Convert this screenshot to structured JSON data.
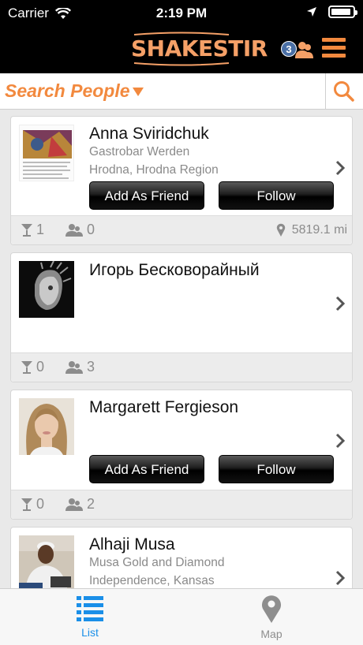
{
  "status": {
    "carrier": "Carrier",
    "time": "2:19 PM"
  },
  "header": {
    "logo": "SHAKESTIR",
    "friend_requests": "3"
  },
  "search": {
    "label": "Search People"
  },
  "people": [
    {
      "name": "Anna Sviridchuk",
      "place": "Gastrobar Werden",
      "location": "Hrodna, Hrodna Region",
      "add_friend": "Add As Friend",
      "follow": "Follow",
      "drinks": "1",
      "friends": "0",
      "distance": "5819.1 mi"
    },
    {
      "name": "Игорь Бесковорайный",
      "drinks": "0",
      "friends": "3"
    },
    {
      "name": "Margarett Fergieson",
      "add_friend": "Add As Friend",
      "follow": "Follow",
      "drinks": "0",
      "friends": "2"
    },
    {
      "name": "Alhaji  Musa",
      "place": "Musa Gold and Diamond",
      "location": "Independence, Kansas"
    }
  ],
  "tabs": [
    {
      "label": "List",
      "icon": "list-icon",
      "active": true,
      "color": "#1a8fe8"
    },
    {
      "label": "Map",
      "icon": "map-pin-icon",
      "active": false,
      "color": "#8e8e8e"
    }
  ],
  "colors": {
    "accent": "#f2893e",
    "active_tab": "#1a8fe8"
  }
}
